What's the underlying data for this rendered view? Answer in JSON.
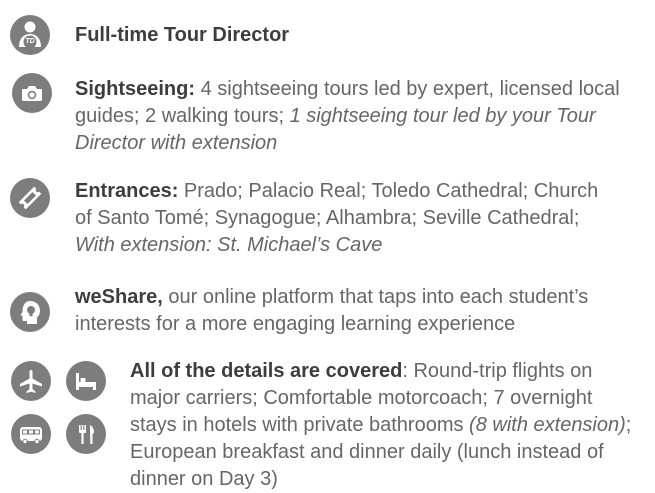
{
  "colors": {
    "icon_bg": "#7d7d7d",
    "heading_text": "#3d3d3d",
    "body_text": "#666666"
  },
  "items": [
    {
      "icon": "tour-director-td-icon",
      "icon_letters": "TD",
      "lead": "Full-time Tour Director"
    },
    {
      "icon": "camera-icon",
      "lead": "Sightseeing:",
      "text": " 4 sightseeing tours led by expert, licensed local guides; 2 walking tours; ",
      "italic": "1 sightseeing tour led by your Tour Director with extension"
    },
    {
      "icon": "ticket-icon",
      "lead": "Entrances:",
      "text": " Prado; Palacio Real; Toledo Cathedral; Church of Santo Tomé; Synagogue; Alhambra; Seville Cathedral; ",
      "italic": "With extension: St. Michael’s Cave"
    },
    {
      "icon": "head-lightbulb-icon",
      "lead": "weShare,",
      "text": " our online platform that taps into each student’s interests for a more engaging learning experience"
    },
    {
      "icons": [
        "airplane-icon",
        "bed-icon",
        "bus-icon",
        "fork-knife-icon"
      ],
      "lead": "All of the details are covered",
      "text": ": Round-trip flights on major carriers; Comfortable motorcoach; 7 overnight stays in hotels with private bathrooms ",
      "italic": "(8 with extension)",
      "text2": "; European breakfast and dinner daily (lunch instead of dinner on Day 3)"
    }
  ]
}
